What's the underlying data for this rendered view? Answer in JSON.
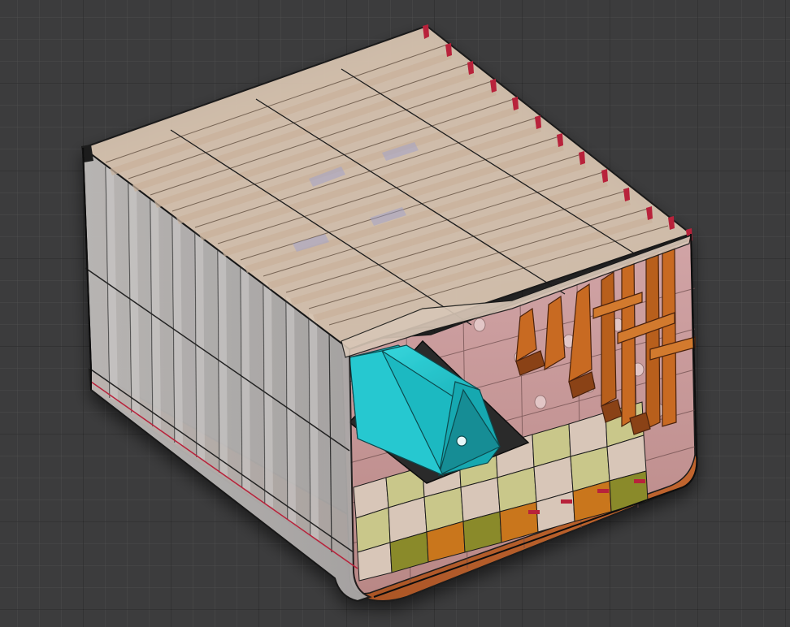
{
  "viewer": {
    "background": "#3c3c3d",
    "grid": true
  },
  "model": {
    "subject": "ship-hull-block-section",
    "colors": {
      "shell_side": "#b9b6b4",
      "shell_edge": "#1a1a1a",
      "deck_plating": "#d7c2ad",
      "deck_girder": "#c9b29c",
      "bulkhead_pink": "#c79a9a",
      "frames_orange": "#c86a22",
      "frames_orange_dark": "#8a4216",
      "bottom_copper": "#b05a2a",
      "bottom_dark": "#5a2a18",
      "tank_cyan": "#20c4cc",
      "tank_cyan_dark": "#0e8b92",
      "foundation_dark": "#2a2a2a",
      "floor_yellow": "#c9c78a",
      "floor_amber": "#c9761c",
      "highlight_red": "#b8213a"
    }
  }
}
